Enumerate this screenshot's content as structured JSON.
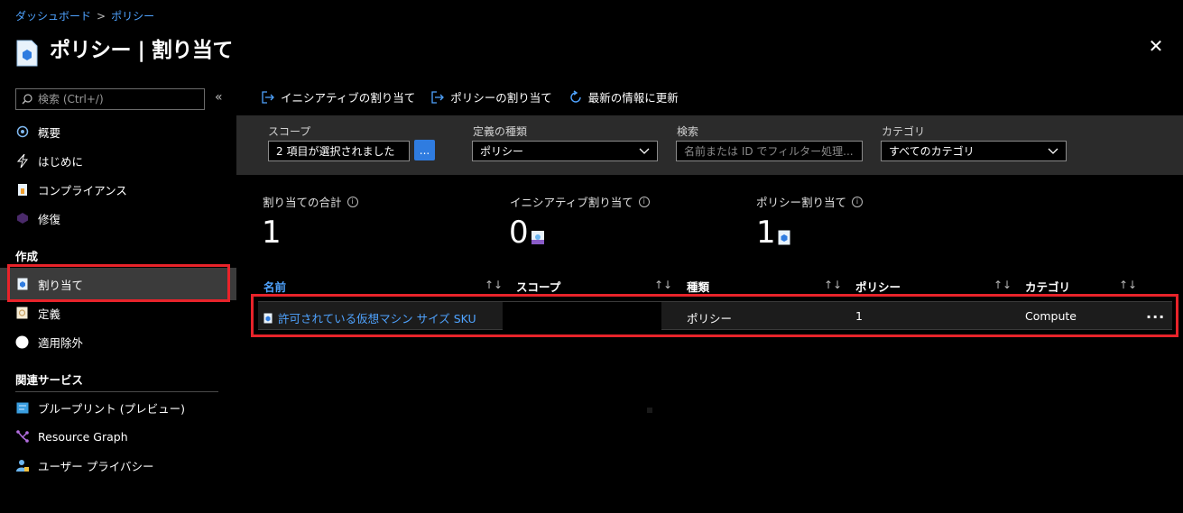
{
  "breadcrumb": {
    "item1": "ダッシュボード",
    "separator": ">",
    "item2": "ポリシー"
  },
  "page": {
    "title": "ポリシー | 割り当て",
    "close_icon": "close-icon"
  },
  "sidebar": {
    "search_placeholder": "検索 (Ctrl+/)",
    "collapse_label": "«",
    "items": [
      {
        "label": "概要",
        "icon": "overview-icon"
      },
      {
        "label": "はじめに",
        "icon": "lightning-icon"
      },
      {
        "label": "コンプライアンス",
        "icon": "compliance-icon"
      },
      {
        "label": "修復",
        "icon": "remediation-icon"
      }
    ],
    "section_authoring": "作成",
    "authoring_items": [
      {
        "label": "割り当て",
        "icon": "assignment-icon",
        "selected": true
      },
      {
        "label": "定義",
        "icon": "definition-icon"
      },
      {
        "label": "適用除外",
        "icon": "exemption-icon"
      }
    ],
    "section_related": "関連サービス",
    "related_items": [
      {
        "label": "ブループリント (プレビュー)",
        "icon": "blueprint-icon"
      },
      {
        "label": "Resource Graph",
        "icon": "resource-graph-icon"
      },
      {
        "label": "ユーザー プライバシー",
        "icon": "user-privacy-icon"
      }
    ]
  },
  "toolbar": {
    "assign_initiative": "イニシアティブの割り当て",
    "assign_policy": "ポリシーの割り当て",
    "refresh": "最新の情報に更新"
  },
  "filters": {
    "scope_label": "スコープ",
    "scope_value": "2 項目が選択されました",
    "scope_button": "...",
    "definition_type_label": "定義の種類",
    "definition_type_value": "ポリシー",
    "search_label": "検索",
    "search_placeholder": "名前または ID でフィルター処理...",
    "category_label": "カテゴリ",
    "category_value": "すべてのカテゴリ"
  },
  "stats": {
    "total_label": "割り当ての合計",
    "total_value": "1",
    "initiative_label": "イニシアティブ割り当て",
    "initiative_value": "0",
    "policy_label": "ポリシー割り当て",
    "policy_value": "1"
  },
  "table": {
    "headers": [
      "名前",
      "スコープ",
      "種類",
      "ポリシー",
      "カテゴリ"
    ],
    "rows": [
      {
        "name": "許可されている仮想マシン サイズ SKU",
        "scope": "",
        "type": "ポリシー",
        "policies": "1",
        "category": "Compute",
        "more": "..."
      }
    ]
  },
  "colors": {
    "accent": "#4fa3ff",
    "highlight_border": "#e8232a",
    "selected_bg": "#3b3b3b",
    "panel_bg": "#2b2b2b"
  }
}
